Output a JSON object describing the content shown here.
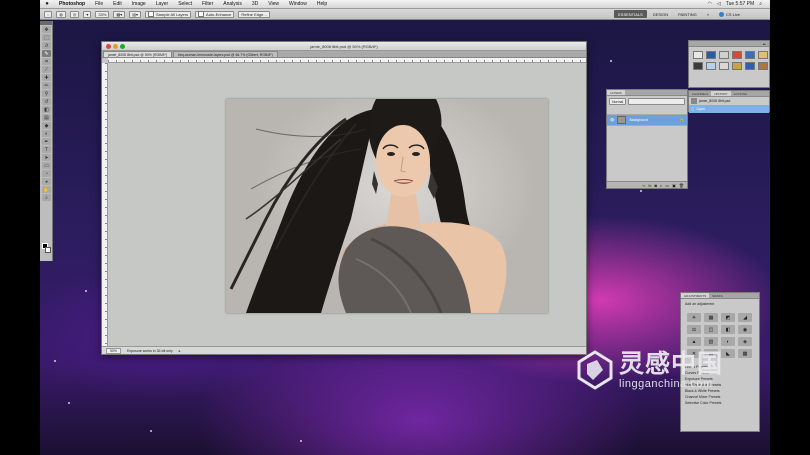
{
  "menubar": {
    "app_name": "Photoshop",
    "items": [
      "File",
      "Edit",
      "Image",
      "Layer",
      "Select",
      "Filter",
      "Analysis",
      "3D",
      "View",
      "Window",
      "Help"
    ],
    "clock": "Tue 5:57 PM"
  },
  "options_bar": {
    "zoom_value": "33%",
    "sample_all_layers_label": "Sample All Layers",
    "auto_enhance_label": "Auto-Enhance",
    "refine_edge_label": "Refine Edge..."
  },
  "workspaces": {
    "items": [
      "ESSENTIALS",
      "DESIGN",
      "PAINTING"
    ],
    "active": "ESSENTIALS",
    "cs_live_label": "CS Live"
  },
  "document": {
    "title": "jamie_8008 8bit.psd @ 50% (RGB/8*)",
    "tabs": [
      "jamie_8008 8bit.psd @ 50% (RGB/8*)",
      "bbq-woman-lemonade-layers.psd @ 66.7% (Gilbert, RGB/8*)"
    ],
    "status_zoom": "50%",
    "status_text": "Exposure works in 32-bit only"
  },
  "swatches_panel": {
    "tabs": [
      "SWATCHES"
    ],
    "colors": [
      "#e03a2f",
      "#6b3b2a",
      "#3b6fb5",
      "#e7e7e7",
      "#2f5fb0",
      "#888888",
      "#c9a24a",
      "#2f2f2f",
      "#b5d1ef",
      "#d8d8d8",
      "#3d6b3a",
      "#e0c070",
      "#cfcfcf",
      "#1a1a1a",
      "#aa7744",
      "#555555",
      "#8aa0b8",
      "#e8a0a0"
    ]
  },
  "styles_panel": {
    "tabs": [
      "STYLES"
    ]
  },
  "layers_panel": {
    "tabs": [
      "LAYERS"
    ],
    "blend_mode": "Normal",
    "layer_name": "Background"
  },
  "history_panel": {
    "tabs": [
      "CHANNELS",
      "HISTORY",
      "ACTIONS"
    ],
    "rows": [
      "jamie_8008 8bit.psd",
      "Open"
    ]
  },
  "adjustments_panel": {
    "tabs": [
      "ADJUSTMENTS",
      "MASKS"
    ],
    "heading": "Add an adjustment",
    "icons_row1": [
      "☀",
      "▦",
      "◩",
      "◢"
    ],
    "icons_row2": [
      "⚖",
      "◫",
      "◧",
      "◉"
    ],
    "icons_row3": [
      "▲",
      "▥",
      "◐",
      "◈"
    ],
    "icons_row4": [
      "✕",
      "▤",
      "◣",
      "▩"
    ],
    "list_items": [
      "Levels Presets",
      "Curves Presets",
      "Exposure Presets",
      "Hue/Saturation Presets",
      "Black & White Presets",
      "Channel Mixer Presets",
      "Selective Color Presets"
    ]
  },
  "watermark": {
    "cn_text": "灵感中国",
    "en_text": "lingganchina.com"
  }
}
